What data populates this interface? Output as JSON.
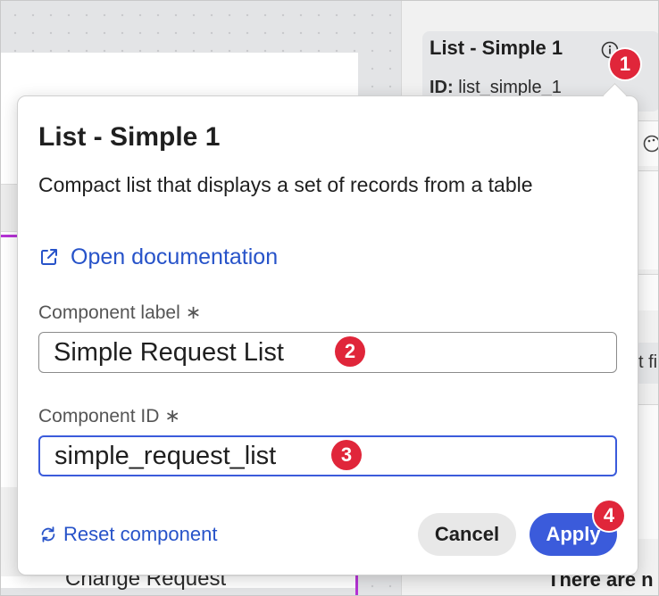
{
  "background": {
    "canvas_text": "Change Request",
    "panel": {
      "title": "List - Simple 1",
      "id_label": "ID:",
      "id_value": "list_simple_1",
      "partial_text": "t fi",
      "bottom_text": "There are n"
    }
  },
  "popover": {
    "title": "List - Simple 1",
    "description": "Compact list that displays a set of records from a table",
    "doc_link": "Open documentation",
    "label_field": {
      "label": "Component label",
      "required_mark": "∗",
      "value": "Simple Request List"
    },
    "id_field": {
      "label": "Component ID",
      "required_mark": "∗",
      "value": "simple_request_list"
    },
    "reset_label": "Reset component",
    "cancel_label": "Cancel",
    "apply_label": "Apply"
  },
  "markers": [
    "1",
    "2",
    "3",
    "4"
  ],
  "colors": {
    "accent": "#3b5bdb",
    "link": "#2753c9",
    "marker": "#e0263a"
  }
}
